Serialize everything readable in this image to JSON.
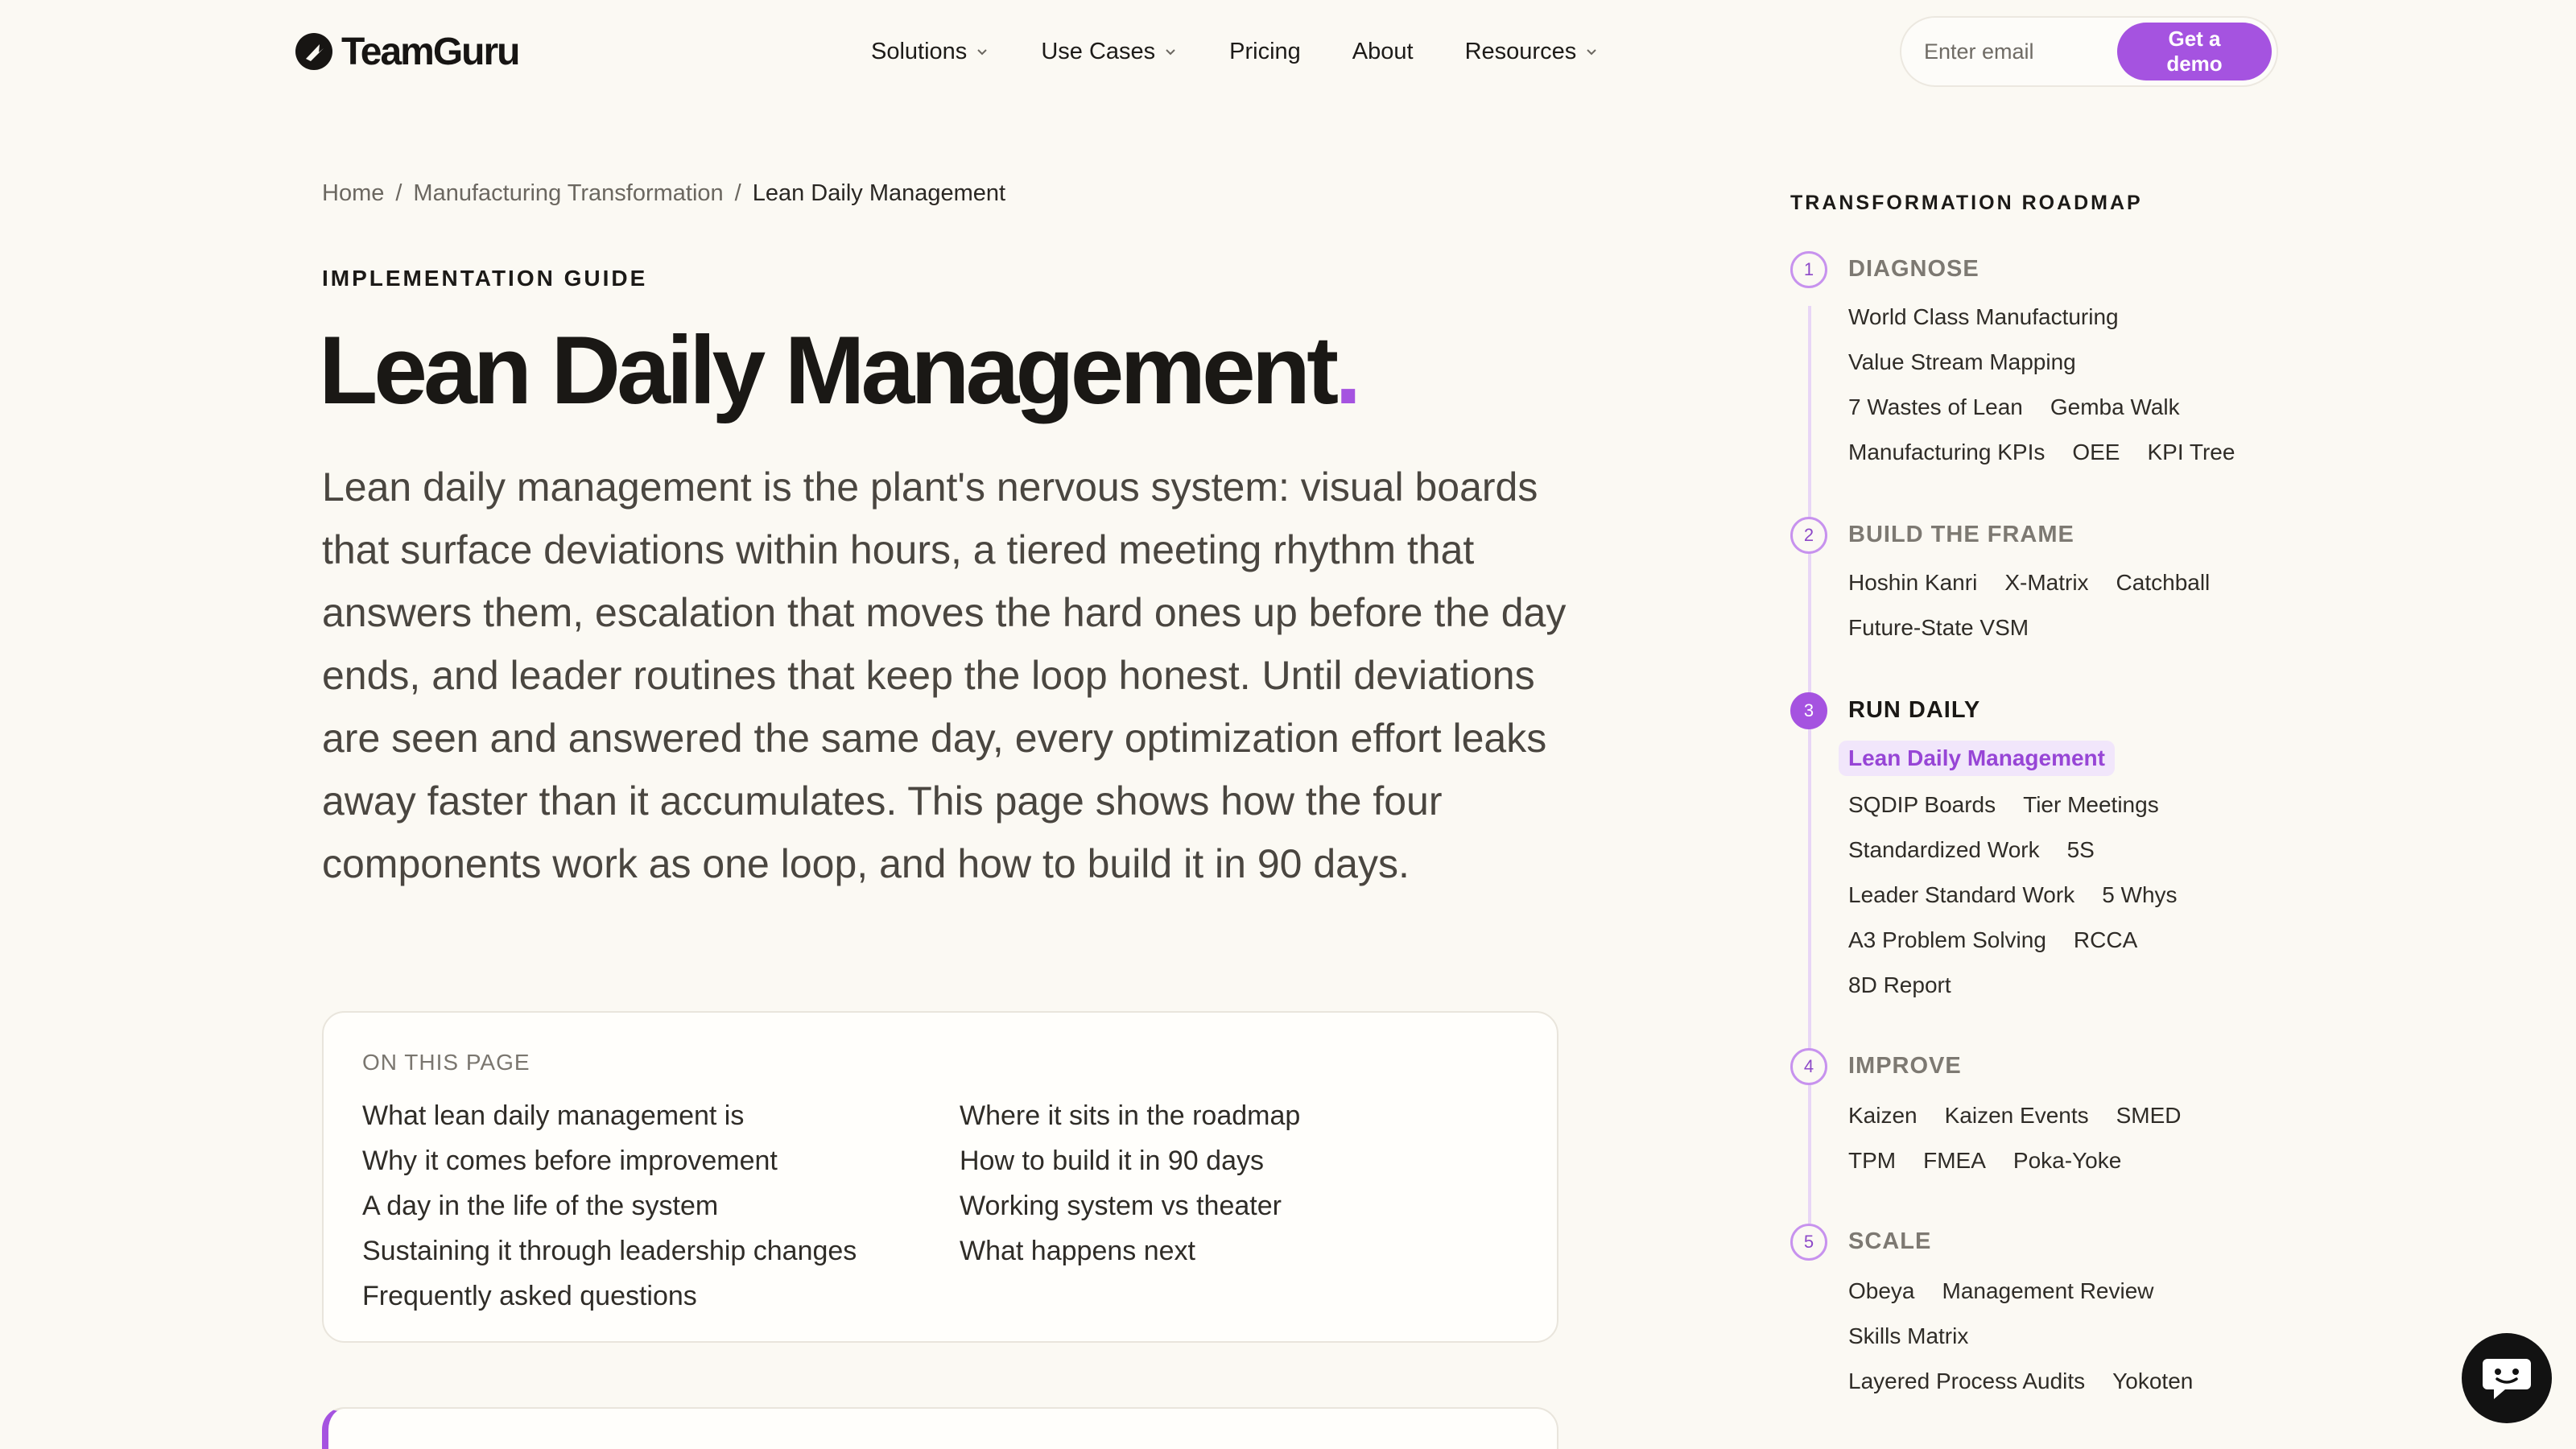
{
  "header": {
    "brand": "TeamGuru",
    "nav": [
      {
        "label": "Solutions",
        "dropdown": true
      },
      {
        "label": "Use Cases",
        "dropdown": true
      },
      {
        "label": "Pricing",
        "dropdown": false
      },
      {
        "label": "About",
        "dropdown": false
      },
      {
        "label": "Resources",
        "dropdown": true
      }
    ],
    "email_placeholder": "Enter email",
    "cta_label": "Get a demo"
  },
  "breadcrumb": {
    "home": "Home",
    "sep": "/",
    "parent": "Manufacturing Transformation",
    "current": "Lean Daily Management"
  },
  "article": {
    "eyebrow": "IMPLEMENTATION GUIDE",
    "title": "Lean Daily Management",
    "title_dot": ".",
    "lead": "Lean daily management is the plant's nervous system: visual boards that surface deviations within hours, a tiered meeting rhythm that answers them, escalation that moves the hard ones up before the day ends, and leader routines that keep the loop honest. Until deviations are seen and answered the same day, every optimization effort leaks away faster than it accumulates. This page shows how the four components work as one loop, and how to build it in 90 days."
  },
  "toc": {
    "label": "ON THIS PAGE",
    "left": [
      "What lean daily management is",
      "Why it comes before improvement",
      "A day in the life of the system",
      "Sustaining it through leadership changes",
      "Frequently asked questions"
    ],
    "right": [
      "Where it sits in the roadmap",
      "How to build it in 90 days",
      "Working system vs theater",
      "What happens next"
    ]
  },
  "roadmap": {
    "title": "TRANSFORMATION ROADMAP",
    "steps": [
      {
        "num": "1",
        "name": "DIAGNOSE",
        "rows": [
          [
            "World Class Manufacturing"
          ],
          [
            "Value Stream Mapping"
          ],
          [
            "7 Wastes of Lean",
            "Gemba Walk"
          ],
          [
            "Manufacturing KPIs",
            "OEE",
            "KPI Tree"
          ]
        ]
      },
      {
        "num": "2",
        "name": "BUILD THE FRAME",
        "rows": [
          [
            "Hoshin Kanri",
            "X-Matrix",
            "Catchball"
          ],
          [
            "Future-State VSM"
          ]
        ]
      },
      {
        "num": "3",
        "name": "RUN DAILY",
        "active": true,
        "rows": [
          [
            "Lean Daily Management"
          ],
          [
            "SQDIP Boards",
            "Tier Meetings"
          ],
          [
            "Standardized Work",
            "5S"
          ],
          [
            "Leader Standard Work",
            "5 Whys"
          ],
          [
            "A3 Problem Solving",
            "RCCA"
          ],
          [
            "8D Report"
          ]
        ]
      },
      {
        "num": "4",
        "name": "IMPROVE",
        "rows": [
          [
            "Kaizen",
            "Kaizen Events",
            "SMED"
          ],
          [
            "TPM",
            "FMEA",
            "Poka-Yoke"
          ]
        ]
      },
      {
        "num": "5",
        "name": "SCALE",
        "rows": [
          [
            "Obeya",
            "Management Review"
          ],
          [
            "Skills Matrix"
          ],
          [
            "Layered Process Audits",
            "Yokoten"
          ]
        ]
      }
    ]
  },
  "colors": {
    "accent": "#a553e0",
    "background": "#fbf9f3"
  },
  "icons": [
    "teamguru-logo-icon",
    "chevron-down-icon",
    "chat-icon"
  ]
}
